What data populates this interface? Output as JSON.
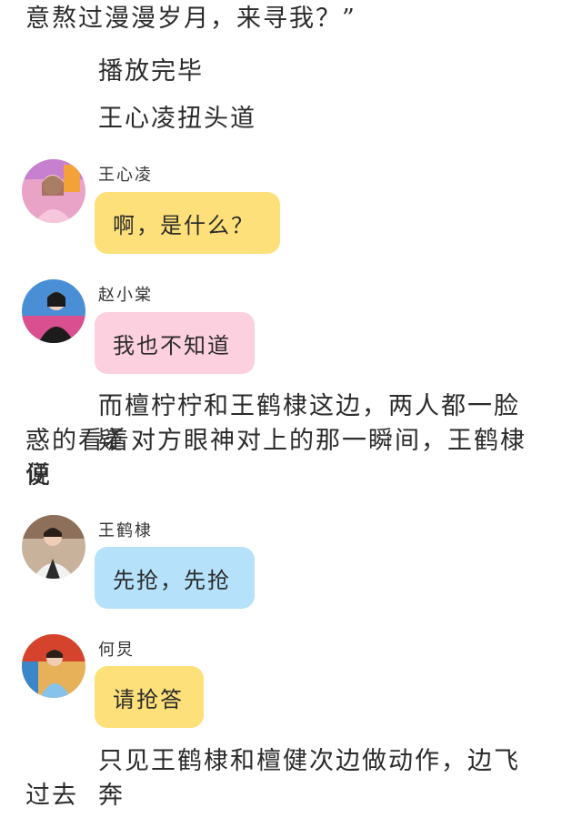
{
  "colors": {
    "yellow_bubble": "#fde07a",
    "pink_bubble": "#fcd0de",
    "blue_bubble": "#b5e1fb",
    "text": "#2b2b2b"
  },
  "paragraphs": {
    "p1": "意熬过漫漫岁月，来寻我？”",
    "p2": "播放完毕",
    "p3": "王心凌扭头道",
    "p4_l1": "而檀柠柠和王鹤棣这边，两人都一脸疑",
    "p4_l2": "惑的看着对方眼神对上的那一瞬间，王鹤棣便",
    "p4_l3": "说",
    "p5_l1": "只见王鹤棣和檀健次边做动作，边飞奔",
    "p5_l2": "过去"
  },
  "messages": [
    {
      "speaker": "王心凌",
      "text": "啊，是什么？",
      "avatar": "woman-pink-avatar",
      "color": "yellow"
    },
    {
      "speaker": "赵小棠",
      "text": "我也不知道",
      "avatar": "woman-black-avatar",
      "color": "pink"
    },
    {
      "speaker": "王鹤棣",
      "text": "先抢，先抢",
      "avatar": "man-vest-avatar",
      "color": "blue"
    },
    {
      "speaker": "何炅",
      "text": "请抢答",
      "avatar": "man-blue-shirt-avatar",
      "color": "yellow"
    }
  ]
}
